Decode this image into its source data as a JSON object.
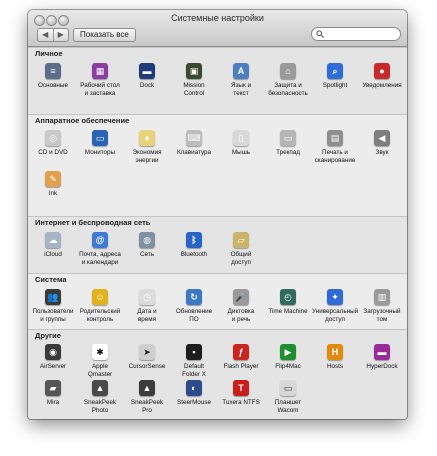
{
  "window": {
    "title": "Системные настройки",
    "show_all": "Показать все",
    "nav_back": "◀",
    "nav_forward": "▶",
    "search": {
      "value": "",
      "placeholder": ""
    }
  },
  "sections": {
    "personal": {
      "title": "Личное",
      "items": [
        {
          "label": "Основные",
          "icon": "general-icon",
          "bg": "#5a6d8a",
          "glyph": "≡"
        },
        {
          "label": "Рабочий стол\nи заставка",
          "icon": "desktop-screensaver-icon",
          "bg": "#8a3fa0",
          "glyph": "▦"
        },
        {
          "label": "Dock",
          "icon": "dock-icon",
          "bg": "#1e3c7a",
          "glyph": "▬"
        },
        {
          "label": "Mission\nControl",
          "icon": "mission-control-icon",
          "bg": "#3a4a2e",
          "glyph": "▣"
        },
        {
          "label": "Язык и\nтекст",
          "icon": "language-text-icon",
          "bg": "#4f7fc3",
          "glyph": "A"
        },
        {
          "label": "Защита и\nбезопасность",
          "icon": "security-house-icon",
          "bg": "#9a9a9a",
          "glyph": "⌂"
        },
        {
          "label": "Spotlight",
          "icon": "spotlight-icon",
          "bg": "#2f6ed8",
          "glyph": "⌕"
        },
        {
          "label": "Уведомления",
          "icon": "notifications-icon",
          "bg": "#c62a2a",
          "glyph": "●"
        }
      ]
    },
    "hardware": {
      "title": "Аппаратное обеспечение",
      "items": [
        {
          "label": "CD и DVD",
          "icon": "cd-dvd-icon",
          "bg": "#c9c9c9",
          "glyph": "◎"
        },
        {
          "label": "Мониторы",
          "icon": "displays-icon",
          "bg": "#2b63b6",
          "glyph": "▭"
        },
        {
          "label": "Экономия\nэнергии",
          "icon": "energy-saver-icon",
          "bg": "#e7d37a",
          "glyph": "♦"
        },
        {
          "label": "Клавиатура",
          "icon": "keyboard-icon",
          "bg": "#bdbdbd",
          "glyph": "⌨"
        },
        {
          "label": "Мышь",
          "icon": "mouse-icon",
          "bg": "#d8d8d8",
          "glyph": "▯"
        },
        {
          "label": "Трекпад",
          "icon": "trackpad-icon",
          "bg": "#b5b5b5",
          "glyph": "▭"
        },
        {
          "label": "Печать и\nсканирование",
          "icon": "print-scan-icon",
          "bg": "#8e8e8e",
          "glyph": "▤"
        },
        {
          "label": "Звук",
          "icon": "sound-icon",
          "bg": "#7e7e7e",
          "glyph": "◀"
        },
        {
          "label": "Ink",
          "icon": "ink-icon",
          "bg": "#e0a050",
          "glyph": "✎"
        }
      ]
    },
    "internet": {
      "title": "Интернет и беспроводная сеть",
      "items": [
        {
          "label": "iCloud",
          "icon": "icloud-icon",
          "bg": "#a6b4c4",
          "glyph": "☁"
        },
        {
          "label": "Почта, адреса\nи календари",
          "icon": "mail-contacts-icon",
          "bg": "#3f7ad6",
          "glyph": "@"
        },
        {
          "label": "Сеть",
          "icon": "network-icon",
          "bg": "#7f8fa4",
          "glyph": "◍"
        },
        {
          "label": "Bluetooth",
          "icon": "bluetooth-icon",
          "bg": "#2a64c8",
          "glyph": "ᛒ"
        },
        {
          "label": "Общий\nдоступ",
          "icon": "sharing-icon",
          "bg": "#c9b46a",
          "glyph": "▱"
        }
      ]
    },
    "system": {
      "title": "Система",
      "items": [
        {
          "label": "Пользователи\nи группы",
          "icon": "users-groups-icon",
          "bg": "#3a3a3a",
          "glyph": "👥"
        },
        {
          "label": "Родительский\nконтроль",
          "icon": "parental-controls-icon",
          "bg": "#e2b21c",
          "glyph": "☺"
        },
        {
          "label": "Дата и\nвремя",
          "icon": "date-time-icon",
          "bg": "#dcdcdc",
          "glyph": "◷"
        },
        {
          "label": "Обновление\nПО",
          "icon": "software-update-icon",
          "bg": "#3b78c8",
          "glyph": "↻"
        },
        {
          "label": "Диктовка\nи речь",
          "icon": "dictation-speech-icon",
          "bg": "#9a9a9a",
          "glyph": "🎤"
        },
        {
          "label": "Time Machine",
          "icon": "time-machine-icon",
          "bg": "#2f6b5e",
          "glyph": "◴"
        },
        {
          "label": "Универсальный\nдоступ",
          "icon": "accessibility-icon",
          "bg": "#2f6ad6",
          "glyph": "✦"
        },
        {
          "label": "Загрузочный\nтом",
          "icon": "startup-disk-icon",
          "bg": "#9a9a9a",
          "glyph": "▥"
        }
      ]
    },
    "other": {
      "title": "Другие",
      "items": [
        {
          "label": "AirServer",
          "icon": "airserver-icon",
          "bg": "#3a3a3a",
          "glyph": "◉"
        },
        {
          "label": "Apple\nQmaster",
          "icon": "apple-qmaster-icon",
          "bg": "#ffffff",
          "glyph": "✱",
          "fg": "#111"
        },
        {
          "label": "CursorSense",
          "icon": "cursorsense-icon",
          "bg": "#cfcfcf",
          "glyph": "➤",
          "fg": "#222"
        },
        {
          "label": "Default\nFolder X",
          "icon": "default-folder-x-icon",
          "bg": "#1d1d1d",
          "glyph": "▪"
        },
        {
          "label": "Flash Player",
          "icon": "flash-player-icon",
          "bg": "#c8261e",
          "glyph": "ƒ"
        },
        {
          "label": "Flip4Mac",
          "icon": "flip4mac-icon",
          "bg": "#1f8e2e",
          "glyph": "▶"
        },
        {
          "label": "Hosts",
          "icon": "hosts-icon",
          "bg": "#e08a10",
          "glyph": "H"
        },
        {
          "label": "HyperDock",
          "icon": "hyperdock-icon",
          "bg": "#9a2a9a",
          "glyph": "▬"
        },
        {
          "label": "Mira",
          "icon": "mira-icon",
          "bg": "#555555",
          "glyph": "▰"
        },
        {
          "label": "SneakPeek\nPhoto",
          "icon": "sneakpeek-photo-icon",
          "bg": "#4a4a4a",
          "glyph": "▲"
        },
        {
          "label": "SneakPeek\nPro",
          "icon": "sneakpeek-pro-icon",
          "bg": "#3c3c3c",
          "glyph": "▲"
        },
        {
          "label": "SteerMouse",
          "icon": "steermouse-icon",
          "bg": "#2d4a8a",
          "glyph": "◐"
        },
        {
          "label": "Tuxera NTFS",
          "icon": "tuxera-ntfs-icon",
          "bg": "#c81e1e",
          "glyph": "T"
        },
        {
          "label": "Планшет Wacom",
          "icon": "wacom-tablet-icon",
          "bg": "#d8d8d8",
          "glyph": "▭",
          "fg": "#333"
        }
      ]
    }
  }
}
